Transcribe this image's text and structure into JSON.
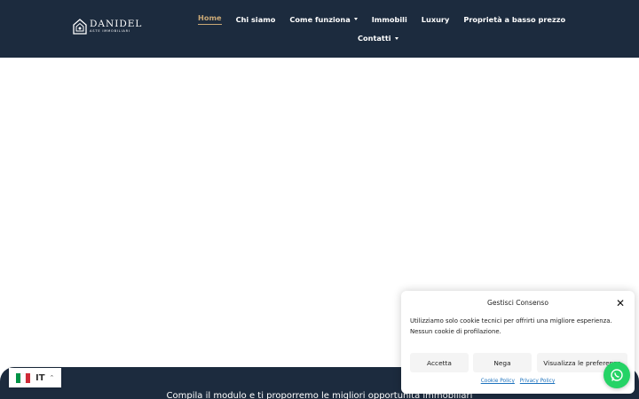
{
  "header": {
    "logo": {
      "name": "DANIDEL",
      "tagline": "ASTE IMMOBILIARI"
    },
    "nav": [
      {
        "label": "Home",
        "active": true,
        "has_dropdown": false
      },
      {
        "label": "Chi siamo",
        "active": false,
        "has_dropdown": false
      },
      {
        "label": "Come funziona",
        "active": false,
        "has_dropdown": true
      },
      {
        "label": "Immobili",
        "active": false,
        "has_dropdown": false
      },
      {
        "label": "Luxury",
        "active": false,
        "has_dropdown": false
      },
      {
        "label": "Proprietà a basso prezzo",
        "active": false,
        "has_dropdown": false
      },
      {
        "label": "Contatti",
        "active": false,
        "has_dropdown": true
      }
    ]
  },
  "footer": {
    "cta_text": "Compila il modulo e ti proporremo le migliori opportunità immobiliari"
  },
  "language_selector": {
    "code": "IT",
    "flag_colors": [
      "#009246",
      "#ffffff",
      "#ce2b37"
    ]
  },
  "cookie_banner": {
    "title": "Gestisci Consenso",
    "message": "Utilizziamo solo cookie tecnici per offrirti una migliore esperienza. Nessun cookie di profilazione.",
    "buttons": {
      "accept": "Accetta",
      "deny": "Nega",
      "preferences": "Visualizza le preferenze"
    },
    "links": {
      "cookie_policy": "Cookie Policy",
      "privacy_policy": "Privacy Policy"
    },
    "close_icon": "close-icon"
  },
  "whatsapp": {
    "icon": "whatsapp-icon",
    "color": "#25d366"
  },
  "colors": {
    "header_bg": "#1c2b3e",
    "accent": "#c9a876",
    "link": "#1e73be"
  }
}
